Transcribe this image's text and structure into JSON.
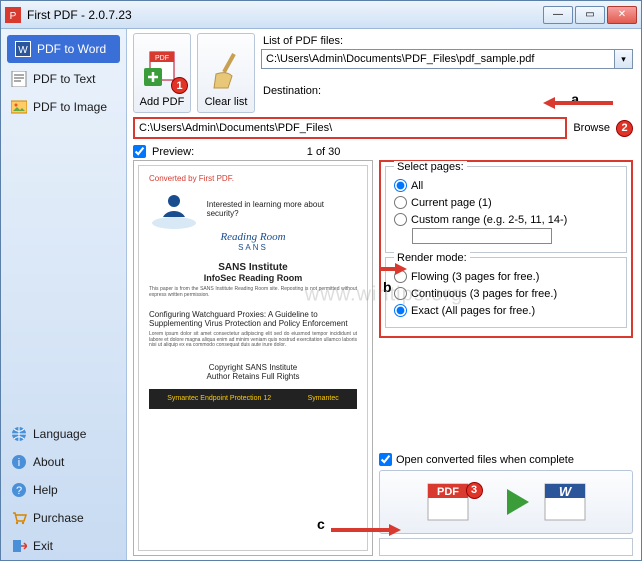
{
  "window": {
    "title": "First PDF - 2.0.7.23"
  },
  "sidebar": {
    "items": [
      {
        "label": "PDF to Word"
      },
      {
        "label": "PDF to Text"
      },
      {
        "label": "PDF to Image"
      }
    ],
    "footer": [
      {
        "label": "Language"
      },
      {
        "label": "About"
      },
      {
        "label": "Help"
      },
      {
        "label": "Purchase"
      },
      {
        "label": "Exit"
      }
    ]
  },
  "toolbar": {
    "add_pdf": "Add PDF",
    "clear_list": "Clear list"
  },
  "list": {
    "label": "List of PDF files:",
    "value": "C:\\Users\\Admin\\Documents\\PDF_Files\\pdf_sample.pdf"
  },
  "dest": {
    "label": "Destination:",
    "value": "C:\\Users\\Admin\\Documents\\PDF_Files\\",
    "browse": "Browse"
  },
  "preview": {
    "checkbox_label": "Preview:",
    "page_indicator": "1 of 30"
  },
  "page": {
    "converted": "Converted by First PDF.",
    "rr_title": "Reading Room",
    "rr_sub": "SANS",
    "rr_side": "Interested in learning more about security?",
    "h1": "SANS Institute",
    "h2": "InfoSec Reading Room",
    "sub": "This paper is from the SANS Institute Reading Room site. Reposting is not permitted without express written permission.",
    "art_title": "Configuring Watchguard Proxies: A Guideline to Supplementing Virus Protection and Policy Enforcement",
    "copyright1": "Copyright SANS Institute",
    "copyright2": "Author Retains Full Rights",
    "banner_left": "Symantec Endpoint Protection 12",
    "banner_right": "Symantec"
  },
  "select_pages": {
    "legend": "Select pages:",
    "all": "All",
    "current": "Current page (1)",
    "custom": "Custom range (e.g. 2-5, 11, 14-)"
  },
  "render_mode": {
    "legend": "Render mode:",
    "flowing": "Flowing (3 pages for free.)",
    "continuous": "Continuous (3 pages for free.)",
    "exact": "Exact (All pages for free.)"
  },
  "open_converted": "Open converted files when complete",
  "markers": {
    "a": "a",
    "b": "b",
    "c": "c",
    "n1": "1",
    "n2": "2",
    "n3": "3"
  },
  "watermark": "www.wintips.org"
}
